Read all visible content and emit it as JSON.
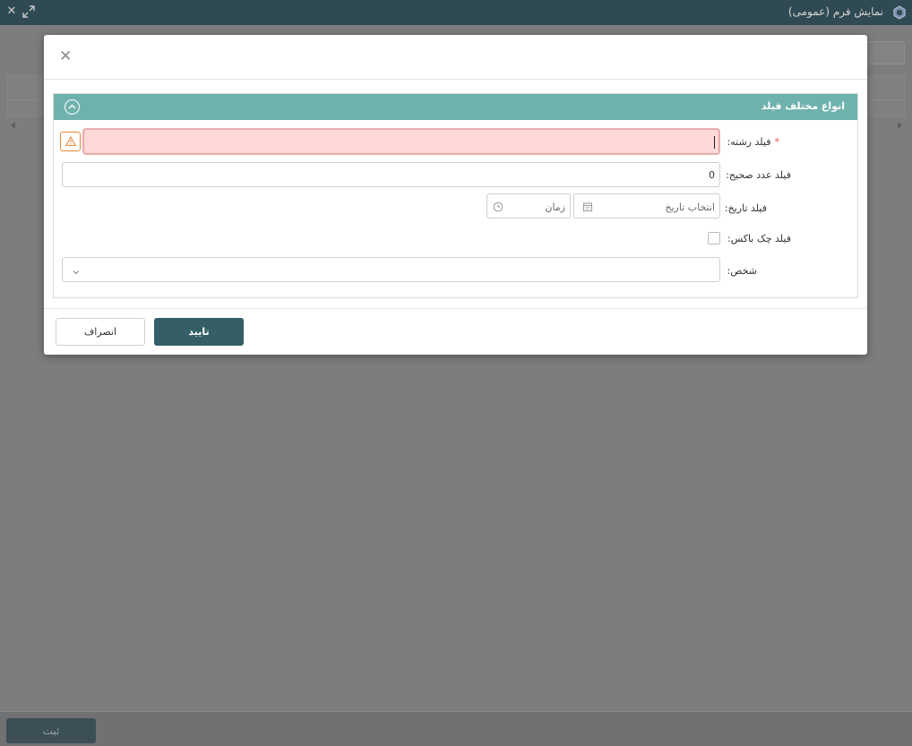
{
  "window": {
    "title": "نمایش فرم (عمومی)",
    "app_icon": "hexagon-logo-icon",
    "close_glyph": "✕",
    "expand_icon": "expand-arrows-icon"
  },
  "modal": {
    "close_glyph": "✕",
    "section": {
      "title": "انواع مختلف فیلد",
      "collapse_icon": "chevron-up-circle-icon"
    },
    "fields": {
      "string": {
        "label": "فیلد رشته:",
        "required_mark": "*",
        "value": "",
        "state": "error",
        "warning_icon": "warning-triangle-icon"
      },
      "integer": {
        "label": "فیلد عدد صحیح:",
        "value": "0"
      },
      "date": {
        "label": "فیلد تاریخ:",
        "date_placeholder": "انتخاب تاریخ",
        "time_placeholder": "زمان",
        "calendar_icon": "calendar-icon",
        "clock_icon": "clock-icon"
      },
      "checkbox": {
        "label": "فیلد چک باکس:",
        "checked": false
      },
      "person": {
        "label": "شخص:",
        "value": "",
        "dropdown_icon": "chevron-down-icon"
      }
    },
    "buttons": {
      "ok": "تایید",
      "cancel": "انصراف"
    }
  },
  "page": {
    "submit_button": "ثبت"
  },
  "colors": {
    "titlebar": "#2f4a52",
    "section_header": "#6fb2ad",
    "primary_button": "#355f66",
    "error_fill": "#ffd8d8",
    "warning": "#e58a3a"
  }
}
